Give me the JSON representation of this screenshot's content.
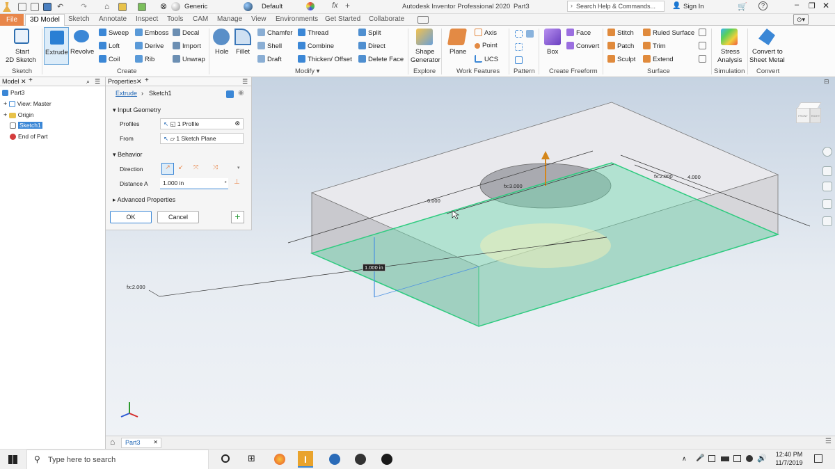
{
  "titlebar": {
    "app_title": "Autodesk Inventor Professional 2020",
    "doc_name": "Part3",
    "appearance": "Generic",
    "material": "Default",
    "search_placeholder": "Search Help & Commands...",
    "sign_in": "Sign In"
  },
  "tabs": {
    "file": "File",
    "items": [
      "3D Model",
      "Sketch",
      "Annotate",
      "Inspect",
      "Tools",
      "CAM",
      "Manage",
      "View",
      "Environments",
      "Get Started",
      "Collaborate"
    ]
  },
  "ribbon": {
    "sketch": {
      "start_line1": "Start",
      "start_line2": "2D Sketch",
      "label": "Sketch"
    },
    "create": {
      "extrude": "Extrude",
      "revolve": "Revolve",
      "sweep": "Sweep",
      "emboss": "Emboss",
      "decal": "Decal",
      "loft": "Loft",
      "derive": "Derive",
      "import": "Import",
      "coil": "Coil",
      "rib": "Rib",
      "unwrap": "Unwrap",
      "label": "Create"
    },
    "modify": {
      "hole": "Hole",
      "fillet": "Fillet",
      "chamfer": "Chamfer",
      "thread": "Thread",
      "split": "Split",
      "shell": "Shell",
      "combine": "Combine",
      "direct": "Direct",
      "draft": "Draft",
      "thicken": "Thicken/ Offset",
      "delete_face": "Delete Face",
      "label": "Modify ▾"
    },
    "explore": {
      "line1": "Shape",
      "line2": "Generator",
      "label": "Explore"
    },
    "work": {
      "plane": "Plane",
      "axis": "Axis",
      "point": "Point",
      "ucs": "UCS",
      "label": "Work Features"
    },
    "pattern": {
      "label": "Pattern"
    },
    "freeform": {
      "box": "Box",
      "face": "Face",
      "convert": "Convert",
      "label": "Create Freeform"
    },
    "surface": {
      "stitch": "Stitch",
      "ruled": "Ruled Surface",
      "patch": "Patch",
      "trim": "Trim",
      "sculpt": "Sculpt",
      "extend": "Extend",
      "label": "Surface"
    },
    "simulation": {
      "line1": "Stress",
      "line2": "Analysis",
      "label": "Simulation"
    },
    "convert": {
      "line1": "Convert to",
      "line2": "Sheet Metal",
      "label": "Convert"
    }
  },
  "browser": {
    "header": "Model",
    "items": {
      "part": "Part3",
      "view": "View: Master",
      "origin": "Origin",
      "sketch": "Sketch1",
      "end": "End of Part"
    }
  },
  "properties": {
    "header": "Properties",
    "crumb_feature": "Extrude",
    "crumb_sketch": "Sketch1",
    "input_geometry": "Input Geometry",
    "profiles_label": "Profiles",
    "profiles_value": "1 Profile",
    "from_label": "From",
    "from_value": "1 Sketch Plane",
    "behavior": "Behavior",
    "direction_label": "Direction",
    "distance_label": "Distance A",
    "distance_value": "1.000 in",
    "advanced": "Advanced Properties",
    "ok": "OK",
    "cancel": "Cancel"
  },
  "viewport": {
    "dim_6000": "6.000",
    "dim_fx3000": "fx:3.000",
    "dim_fx2000_top": "fx:2.000",
    "dim_4000": "4.000",
    "dim_fx2000_left": "fx:2.000",
    "extent_value": "1.000 in",
    "viewcube_front": "FRONT",
    "viewcube_right": "RIGHT"
  },
  "doc_tab": {
    "name": "Part3"
  },
  "taskbar": {
    "search_placeholder": "Type here to search",
    "time": "12:40 PM",
    "date": "11/7/2019"
  },
  "colors": {
    "accent": "#e8864a",
    "highlight_blue": "#2a7fd4",
    "preview_green": "#3ed397"
  }
}
